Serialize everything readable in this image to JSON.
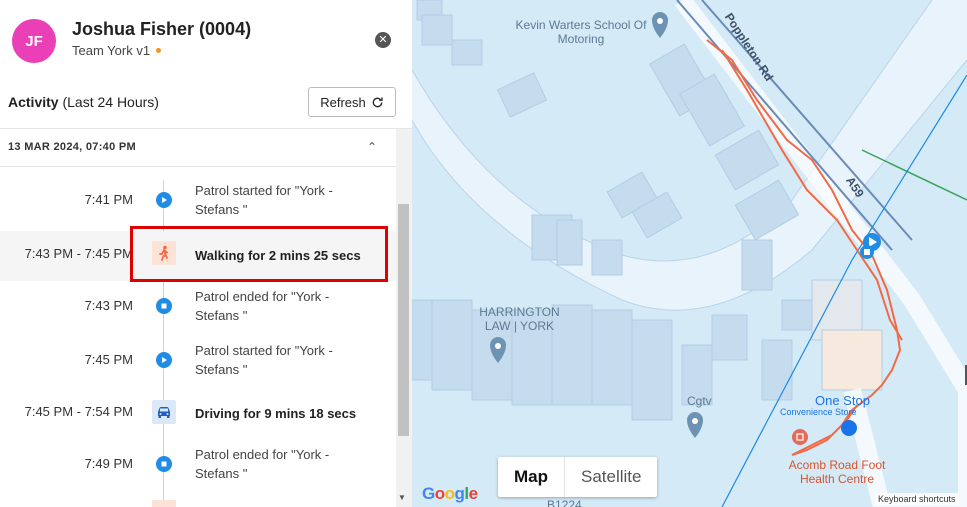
{
  "header": {
    "avatar_initials": "JF",
    "user_name": "Joshua Fisher (0004)",
    "team": "Team York v1",
    "team_status_color": "#f7941d",
    "close_icon": "close-icon"
  },
  "activity": {
    "title_bold": "Activity",
    "title_rest": " (Last 24 Hours)",
    "refresh_label": "Refresh",
    "date_group": "13 MAR 2024, 07:40 PM"
  },
  "events": [
    {
      "time": "7:41 PM",
      "desc": "Patrol started for \"York - Stefans \"",
      "icon": "play-icon",
      "bold": false
    },
    {
      "time": "7:43 PM - 7:45 PM",
      "desc": "Walking for 2 mins 25 secs",
      "icon": "walking-icon",
      "bold": true
    },
    {
      "time": "7:43 PM",
      "desc": "Patrol ended for \"York - Stefans \"",
      "icon": "stop-icon",
      "bold": false
    },
    {
      "time": "7:45 PM",
      "desc": "Patrol started for \"York - Stefans \"",
      "icon": "play-icon",
      "bold": false
    },
    {
      "time": "7:45 PM - 7:54 PM",
      "desc": "Driving for 9 mins 18 secs",
      "icon": "car-icon",
      "bold": true
    },
    {
      "time": "7:49 PM",
      "desc": "Patrol ended for \"York - Stefans \"",
      "icon": "stop-icon",
      "bold": false
    }
  ],
  "map": {
    "labels": {
      "school": "Kevin Warters School Of Motoring",
      "road1": "Poppleton Rd",
      "road2": "A59",
      "harrington": "HARRINGTON LAW | YORK",
      "cgtv": "Cgtv",
      "onestop": "One Stop",
      "onestop_sub": "Convenience Store",
      "acomb": "Acomb Road Foot Health Centre",
      "road3": "B1224"
    },
    "toggle": {
      "map": "Map",
      "satellite": "Satellite",
      "active": "map"
    },
    "google": "Google",
    "keyboard": "Keyboard shortcuts",
    "route_color": "#f26a45"
  }
}
